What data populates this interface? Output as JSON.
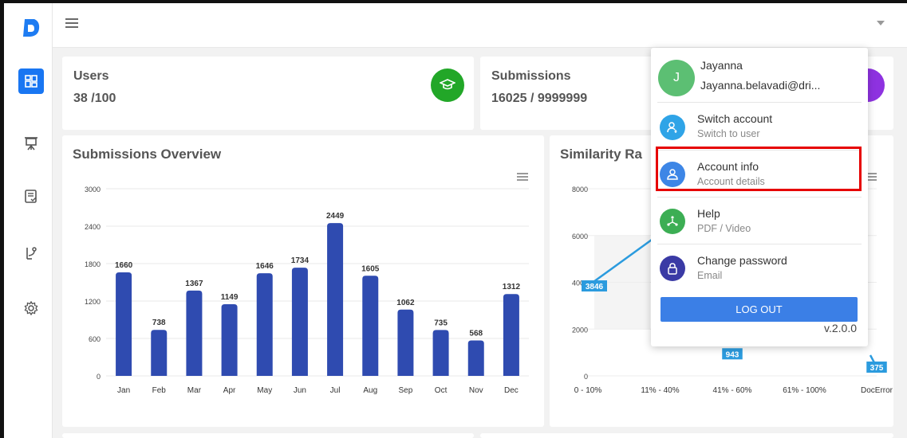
{
  "cards": {
    "users": {
      "title": "Users",
      "value": "38 /100"
    },
    "submissions": {
      "title": "Submissions",
      "value": "16025 / 9999999"
    }
  },
  "panels": {
    "overview_title": "Submissions Overview",
    "similarity_title": "Similarity Ra"
  },
  "user": {
    "initial": "J",
    "name": "Jayanna",
    "email": "Jayanna.belavadi@dri..."
  },
  "menu": {
    "items": [
      {
        "label": "Switch account",
        "sub": "Switch to user",
        "icon": "switch-user-icon",
        "color": "#2fa4e7"
      },
      {
        "label": "Account info",
        "sub": "Account details",
        "icon": "account-icon",
        "color": "#3d86e6"
      },
      {
        "label": "Help",
        "sub": "PDF / Video",
        "icon": "help-icon",
        "color": "#3cae54"
      },
      {
        "label": "Change password",
        "sub": "Email",
        "icon": "lock-icon",
        "color": "#3a3aa5"
      }
    ],
    "logout_label": "LOG OUT",
    "version": "v.2.0.0"
  },
  "chart_data": [
    {
      "type": "bar",
      "title": "Submissions Overview",
      "categories": [
        "Jan",
        "Feb",
        "Mar",
        "Apr",
        "May",
        "Jun",
        "Jul",
        "Aug",
        "Sep",
        "Oct",
        "Nov",
        "Dec"
      ],
      "values": [
        1660,
        738,
        1367,
        1149,
        1646,
        1734,
        2449,
        1605,
        1062,
        735,
        568,
        1312
      ],
      "yticks": [
        0,
        600,
        1200,
        1800,
        2400,
        3000
      ],
      "ylim": [
        0,
        3000
      ],
      "color": "#2f4bb0"
    },
    {
      "type": "line",
      "title": "Similarity Ra",
      "categories": [
        "0 - 10%",
        "11% - 40%",
        "41% - 60%",
        "61% - 100%",
        "DocError"
      ],
      "visible_labels": [
        {
          "category": "0 - 10%",
          "value": "3846"
        },
        {
          "category": "41% - 60%",
          "value": "943"
        },
        {
          "category": "DocError",
          "value": "375"
        }
      ],
      "yticks": [
        0,
        2000,
        4000,
        6000,
        8000
      ],
      "ylim": [
        0,
        8000
      ],
      "color": "#2b9bde"
    }
  ],
  "colors": {
    "primary": "#1976f2",
    "users_badge": "#22a728",
    "submissions_badge": "#8e32e0",
    "highlight": "#e60000"
  }
}
